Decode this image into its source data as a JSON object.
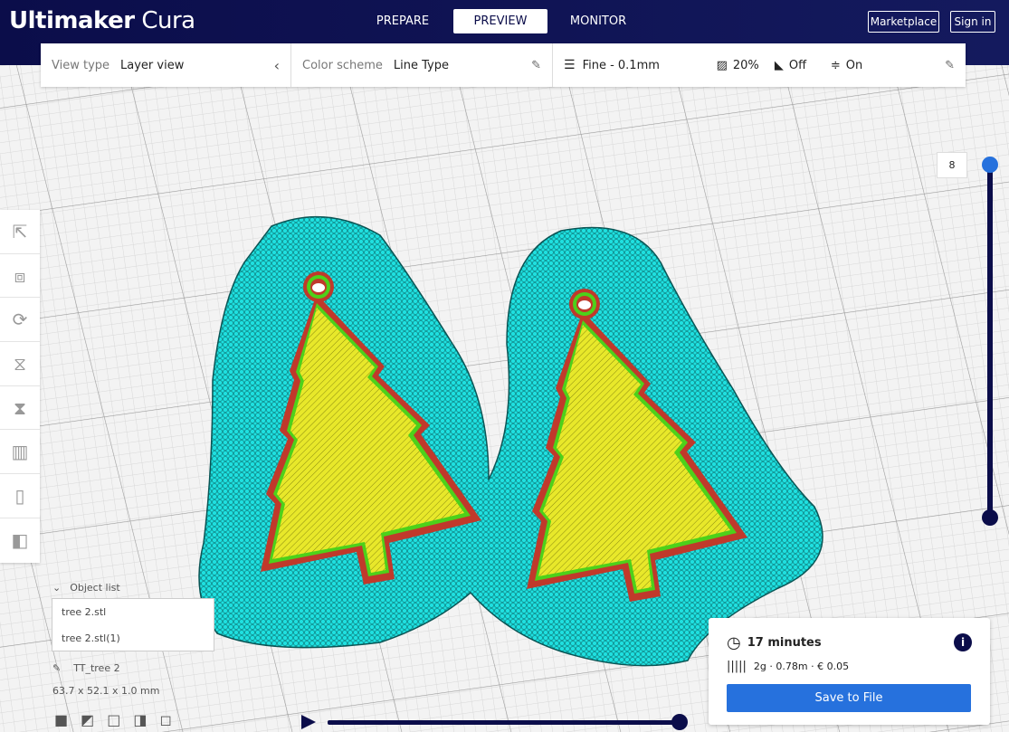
{
  "app": {
    "brand_bold": "Ultimaker",
    "brand_light": "Cura"
  },
  "nav": {
    "tabs": [
      {
        "label": "PREPARE"
      },
      {
        "label": "PREVIEW",
        "active": true
      },
      {
        "label": "MONITOR"
      }
    ],
    "marketplace": "Marketplace",
    "sign_in": "Sign in"
  },
  "toolbar": {
    "view_type_label": "View type",
    "view_type_value": "Layer view",
    "color_scheme_label": "Color scheme",
    "color_scheme_value": "Line Type",
    "profile": "Fine - 0.1mm",
    "infill": "20%",
    "support": "Off",
    "adhesion": "On"
  },
  "layer_slider": {
    "current_layer": "8"
  },
  "objects": {
    "header": "Object list",
    "items": [
      "tree 2.stl",
      "tree 2.stl(1)"
    ],
    "selected_name": "TT_tree 2",
    "dimensions": "63.7 x 52.1 x 1.0 mm"
  },
  "summary": {
    "time": "17 minutes",
    "material": "2g · 0.78m · € 0.05",
    "save_label": "Save to File"
  },
  "playback": {
    "progress": 1.0
  },
  "colors": {
    "accent": "#2671dd",
    "header": "#0b0d4a",
    "skirt": "#00e5e5",
    "infill": "#e8e82a",
    "wall_outer": "#c0392b",
    "wall_inner": "#4dd11a"
  }
}
